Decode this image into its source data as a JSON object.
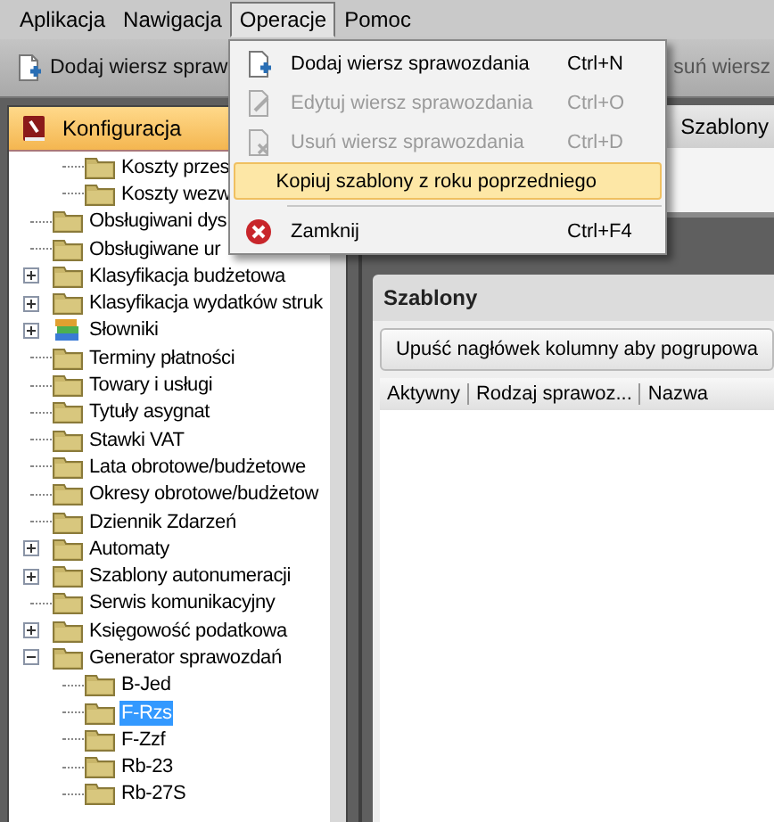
{
  "menu_bar": [
    {
      "label": "Aplikacja",
      "open": false
    },
    {
      "label": "Nawigacja",
      "open": false
    },
    {
      "label": "Operacje",
      "open": true
    },
    {
      "label": "Pomoc",
      "open": false
    }
  ],
  "toolbar": {
    "buttons": [
      {
        "label": "Dodaj wiersz spraw",
        "kind": "add"
      },
      {
        "label": "suń wiersz",
        "kind": "plain"
      }
    ]
  },
  "left_panel": {
    "title": "Konfiguracja",
    "tree": {
      "scrolled_parent_children": [
        {
          "label": "Koszty przes",
          "kind": "folder",
          "selected": false
        },
        {
          "label": "Koszty wezw",
          "kind": "folder",
          "selected": false
        }
      ],
      "items": [
        {
          "label": "Obsługiwani dys",
          "kind": "folder",
          "selected": false
        },
        {
          "label": "Obsługiwane ur",
          "kind": "folder",
          "selected": false
        },
        {
          "label": "Klasyfikacja budżetowa",
          "kind": "folder",
          "selected": false,
          "expanded": false
        },
        {
          "label": "Klasyfikacja wydatków struk",
          "kind": "folder",
          "selected": false,
          "expanded": false
        },
        {
          "label": "Słowniki",
          "kind": "books",
          "selected": false,
          "expanded": false
        },
        {
          "label": "Terminy płatności",
          "kind": "folder",
          "selected": false
        },
        {
          "label": "Towary i usługi",
          "kind": "folder",
          "selected": false
        },
        {
          "label": "Tytuły asygnat",
          "kind": "folder",
          "selected": false
        },
        {
          "label": "Stawki VAT",
          "kind": "folder",
          "selected": false
        },
        {
          "label": "Lata obrotowe/budżetowe",
          "kind": "folder",
          "selected": false
        },
        {
          "label": "Okresy obrotowe/budżetow",
          "kind": "folder",
          "selected": false
        },
        {
          "label": "Dziennik Zdarzeń",
          "kind": "folder",
          "selected": false
        },
        {
          "label": "Automaty",
          "kind": "folder",
          "selected": false,
          "expanded": false
        },
        {
          "label": "Szablony autonumeracji",
          "kind": "folder",
          "selected": false,
          "expanded": false
        },
        {
          "label": "Serwis komunikacyjny",
          "kind": "folder",
          "selected": false
        },
        {
          "label": "Księgowość podatkowa",
          "kind": "folder",
          "selected": false,
          "expanded": false
        },
        {
          "label": "Generator sprawozdań",
          "kind": "folder",
          "selected": false,
          "expanded": true,
          "children": [
            {
              "label": "B-Jed",
              "kind": "folder",
              "selected": false
            },
            {
              "label": "F-Rzs",
              "kind": "folder",
              "selected": true
            },
            {
              "label": "F-Zzf",
              "kind": "folder",
              "selected": false
            },
            {
              "label": "Rb-23",
              "kind": "folder",
              "selected": false
            },
            {
              "label": "Rb-27S",
              "kind": "folder",
              "selected": false
            }
          ]
        }
      ]
    }
  },
  "right_panel": {
    "top_button": "Szablony",
    "grid_panel": {
      "title": "Szablony",
      "group_hint": "Upuść nagłówek kolumny aby pogrupowa",
      "columns": [
        "Aktywny",
        "Rodzaj sprawoz...",
        "Nazwa"
      ]
    }
  },
  "dropdown_menu": [
    {
      "kind": "add",
      "label": "Dodaj wiersz sprawozdania",
      "shortcut": "Ctrl+N",
      "disabled": false,
      "highlighted": false
    },
    {
      "kind": "edit",
      "label": "Edytuj wiersz sprawozdania",
      "shortcut": "Ctrl+O",
      "disabled": true,
      "highlighted": false
    },
    {
      "kind": "delete",
      "label": "Usuń wiersz sprawozdania",
      "shortcut": "Ctrl+D",
      "disabled": true,
      "highlighted": false
    },
    {
      "kind": "plain",
      "label": "Kopiuj szablony z roku poprzedniego",
      "disabled": false,
      "highlighted": true
    },
    {
      "kind": "separator"
    },
    {
      "kind": "close",
      "label": "Zamknij",
      "shortcut": "Ctrl+F4",
      "disabled": false,
      "highlighted": false
    }
  ]
}
